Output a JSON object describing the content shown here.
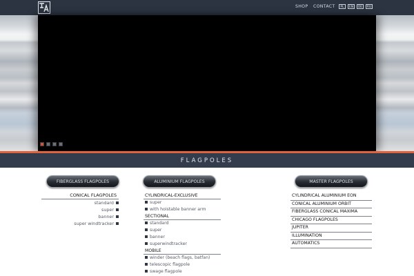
{
  "header": {
    "nav": {
      "shop": "SHOP",
      "contact": "CONTACT"
    },
    "languages": [
      "PL",
      "EN",
      "DE",
      "RU"
    ]
  },
  "slider": {
    "dot_count": 4,
    "active_index": 0
  },
  "section": {
    "title": "FLAGPOLES"
  },
  "columns": {
    "fiberglass": {
      "button": "FIBERGLASS FLAGPOLES",
      "heading": "CONICAL FLAGPOLES",
      "items": [
        "standard",
        "super",
        "banner",
        "super windtracker"
      ]
    },
    "aluminium": {
      "button": "ALUMINIUM FLAGPOLES",
      "groups": [
        {
          "heading": "CYLINDRICAL-EXCLUSIVE",
          "items": [
            "super",
            "with hoistable banner arm"
          ]
        },
        {
          "heading": "SECTIONAL",
          "items": [
            "standard",
            "super",
            "banner",
            "superwindtracker"
          ]
        },
        {
          "heading": "MOBILE",
          "items": [
            "winder (beach flags, batfan)",
            "telescopic flagpole",
            "swage flagpole"
          ]
        }
      ]
    },
    "master": {
      "button": "MASTER FLAGPOLES",
      "items": [
        "CYLINDRICAL ALUMINIUM EON",
        "CONICAL ALUMINIUM ORBIT",
        "FIBERGLASS CONICAL MAXIMA",
        "CHICAGO FLAGPOLES",
        "JUPITER",
        "ILLUMINATION",
        "AUTOMATICS"
      ]
    }
  },
  "colors": {
    "header_bg": "#2c3441",
    "accent": "#e0633c",
    "section_bg": "#333c4c"
  }
}
